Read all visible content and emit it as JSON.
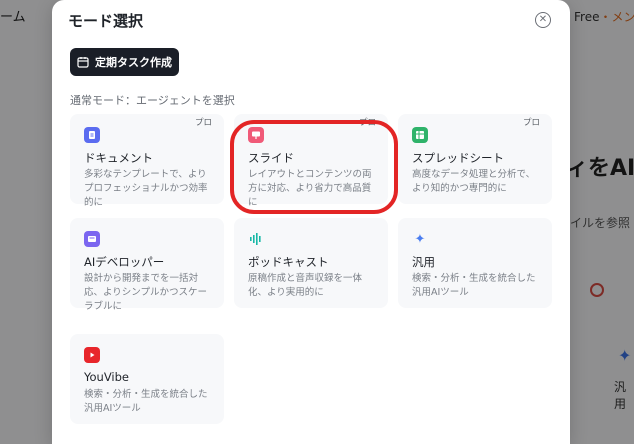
{
  "background": {
    "left_text": "ーム",
    "free_label": "Free",
    "free_suffix": "・メン",
    "headline": "ィをAI",
    "sub_text": "イルを参照",
    "general_label": "汎用"
  },
  "modal": {
    "title": "モード選択",
    "close_symbol": "✕",
    "task_button_label": "定期タスク作成",
    "section_label": "通常モード：エージェントを選択",
    "cards": [
      {
        "name": "ドキュメント",
        "desc": "多彩なテンプレートで、よりプロフェッショナルかつ効率的に",
        "badge": "プロ",
        "icon": "document-icon",
        "color": "#5b6cf0"
      },
      {
        "name": "スライド",
        "desc": "レイアウトとコンテンツの両方に対応、より省力で高品質に",
        "badge": "プロ",
        "icon": "slide-icon",
        "color": "#f05a78"
      },
      {
        "name": "スプレッドシート",
        "desc": "高度なデータ処理と分析で、より知的かつ専門的に",
        "badge": "プロ",
        "icon": "spreadsheet-icon",
        "color": "#2fb36a"
      },
      {
        "name": "AIデベロッパー",
        "desc": "設計から開発までを一括対応、よりシンプルかつスケーラブルに",
        "badge": "",
        "icon": "developer-icon",
        "color": "#7b66f0"
      },
      {
        "name": "ポッドキャスト",
        "desc": "原稿作成と音声収録を一体化、より実用的に",
        "badge": "",
        "icon": "podcast-icon",
        "color": "#17b8a6"
      },
      {
        "name": "汎用",
        "desc": "検索・分析・生成を統合した汎用AIツール",
        "badge": "",
        "icon": "sparkle-icon",
        "color": "#4a7df0"
      },
      {
        "name": "YouVibe",
        "desc": "検索・分析・生成を統合した汎用AIツール",
        "badge": "",
        "icon": "youtube-icon",
        "color": "#e8262b"
      }
    ]
  }
}
